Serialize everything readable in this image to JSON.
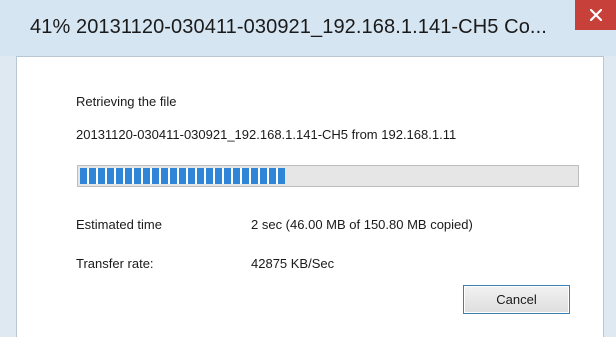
{
  "window": {
    "title": "41% 20131120-030411-030921_192.168.1.141-CH5 Co..."
  },
  "dialog": {
    "status_heading": "Retrieving the file",
    "file_line": "20131120-030411-030921_192.168.1.141-CH5 from 192.168.1.11",
    "progress": {
      "percent": 41
    },
    "estimated_time_label": "Estimated time",
    "estimated_time_value": "2 sec (46.00 MB of 150.80 MB copied)",
    "transfer_rate_label": "Transfer rate:",
    "transfer_rate_value": "42875 KB/Sec",
    "cancel_label": "Cancel"
  },
  "icons": {
    "close": "close-icon"
  },
  "colors": {
    "titlebar": "#d6e5f2",
    "close_button": "#c7403a",
    "progress_fill": "#2f86d8",
    "button_border": "#3c7fb1"
  }
}
